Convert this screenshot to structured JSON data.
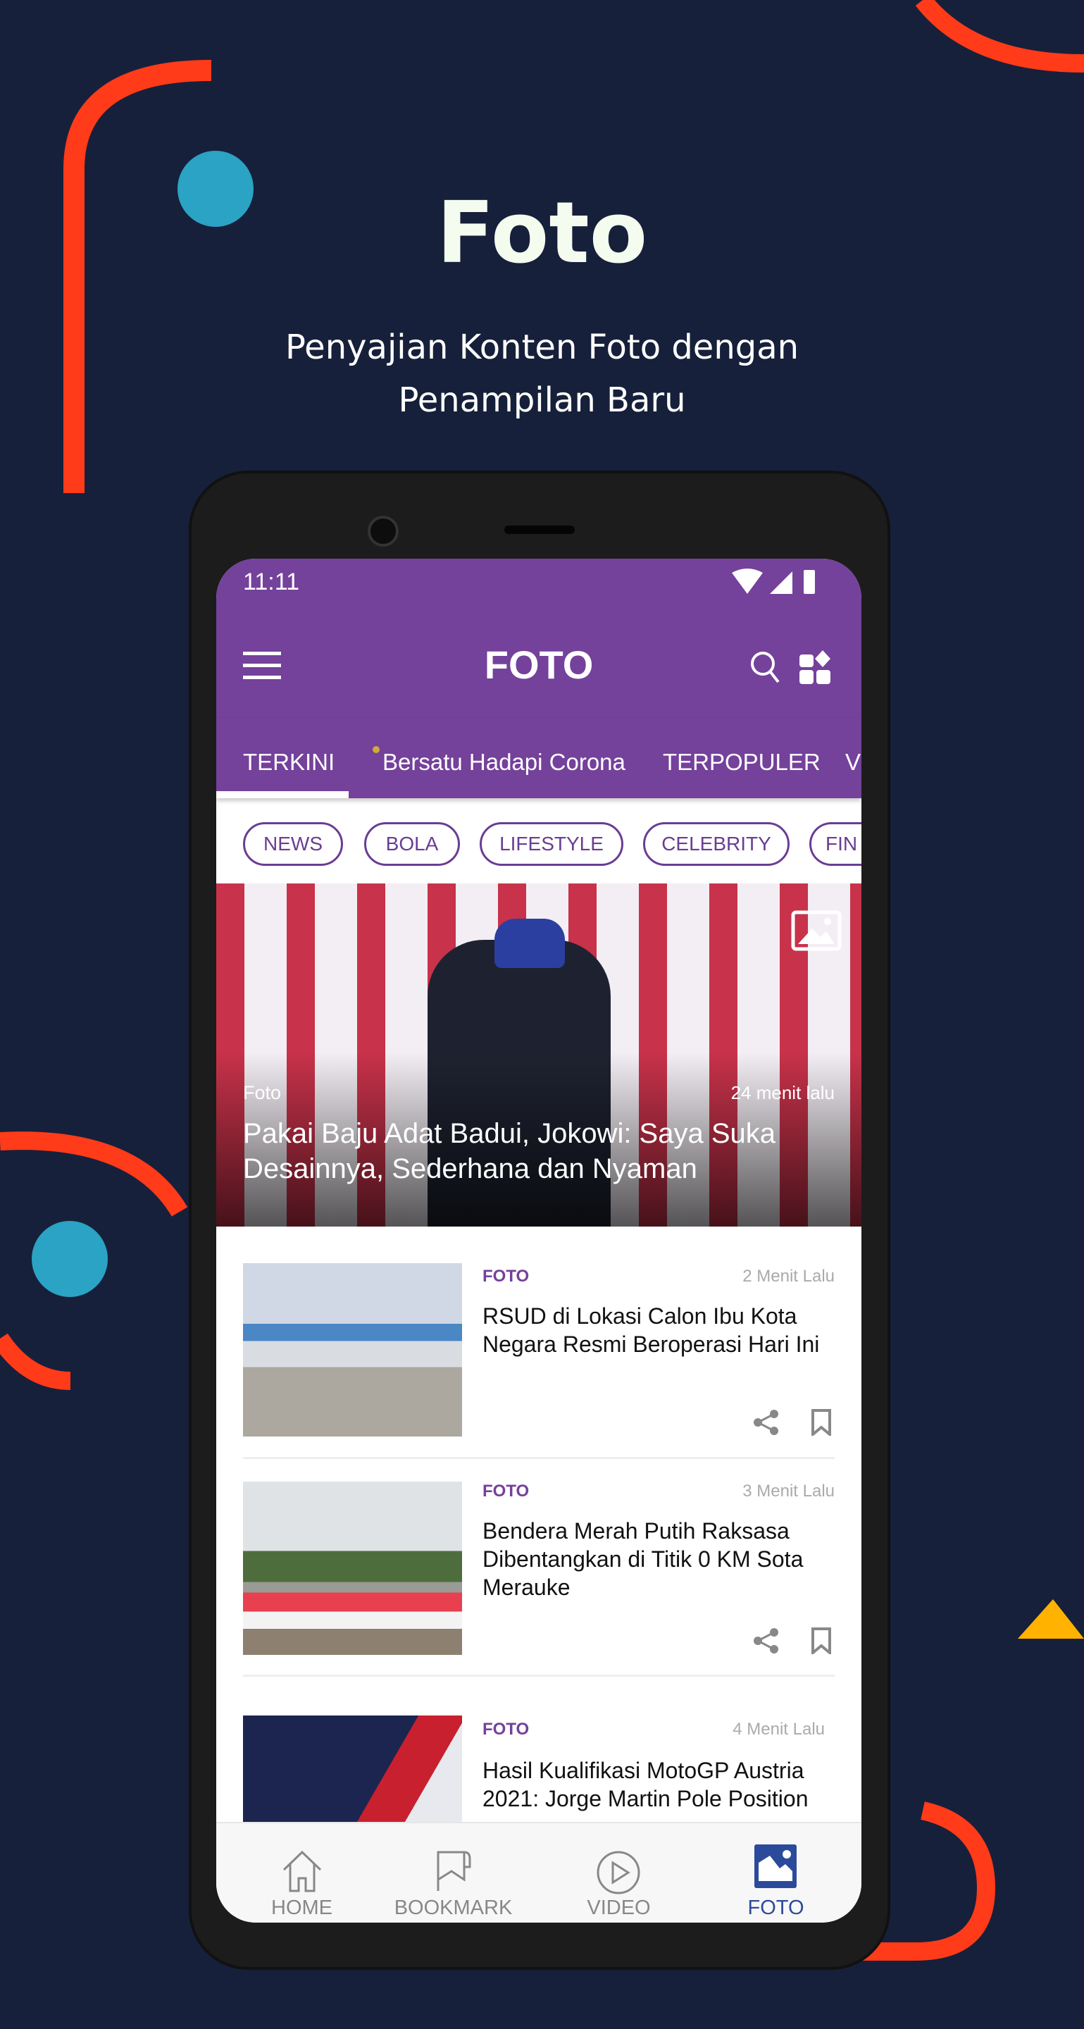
{
  "promo": {
    "title": "Foto",
    "subtitle_line1": "Penyajian Konten Foto dengan",
    "subtitle_line2": "Penampilan Baru"
  },
  "status_bar": {
    "time": "11:11",
    "icons": [
      "wifi-icon",
      "signal-icon",
      "battery-icon"
    ]
  },
  "app_bar": {
    "title": "FOTO",
    "icons": [
      "menu-icon",
      "search-icon",
      "apps-icon"
    ]
  },
  "colors": {
    "primary": "#74419b",
    "background": "#17203a",
    "accent": "#ff4a1c",
    "nav_active": "#2c4a9a"
  },
  "tabs": [
    {
      "label": "TERKINI",
      "active": true
    },
    {
      "label": "Bersatu Hadapi Corona"
    },
    {
      "label": "TERPOPULER"
    },
    {
      "label": "V"
    }
  ],
  "chips": [
    "NEWS",
    "BOLA",
    "LIFESTYLE",
    "CELEBRITY",
    "FIN"
  ],
  "hero": {
    "category": "Foto",
    "time": "24 menit lalu",
    "title": "Pakai Baju Adat Badui, Jokowi: Saya Suka Desainnya, Sederhana dan Nyaman"
  },
  "articles": [
    {
      "category": "FOTO",
      "time": "2 Menit Lalu",
      "title": "RSUD di Lokasi Calon Ibu Kota Negara Resmi Beroperasi Hari Ini"
    },
    {
      "category": "FOTO",
      "time": "3 Menit Lalu",
      "title": "Bendera Merah Putih Raksasa Dibentangkan di Titik 0 KM Sota Merauke"
    },
    {
      "category": "FOTO",
      "time": "4 Menit Lalu",
      "title": "Hasil Kualifikasi MotoGP Austria 2021: Jorge Martin Pole Position"
    }
  ],
  "bottom_nav": [
    {
      "label": "HOME"
    },
    {
      "label": "BOOKMARK"
    },
    {
      "label": "VIDEO"
    },
    {
      "label": "FOTO",
      "active": true
    }
  ]
}
